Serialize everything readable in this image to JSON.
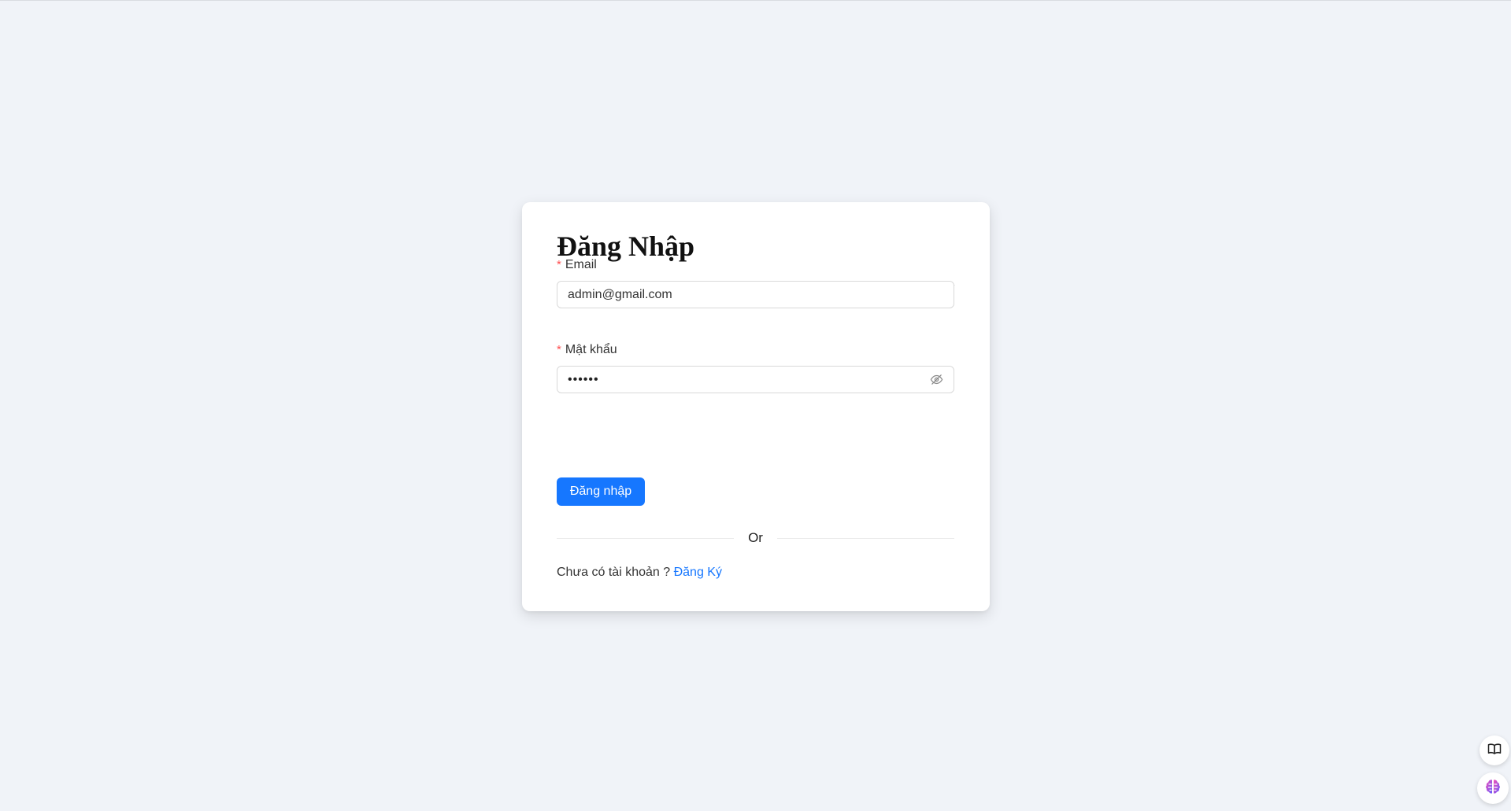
{
  "page": {
    "title": "Đăng Nhập"
  },
  "form": {
    "email": {
      "label": "Email",
      "required_mark": "*",
      "value": "admin@gmail.com"
    },
    "password": {
      "label": "Mật khẩu",
      "required_mark": "*",
      "masked_value": "••••••"
    },
    "submit_label": "Đăng nhập",
    "divider_text": "Or",
    "signup_prompt": "Chưa có tài khoản ?",
    "signup_link": "Đăng Ký"
  },
  "floating": {
    "book_icon": "book-icon",
    "brain_icon": "brain-icon"
  },
  "colors": {
    "primary": "#1677ff",
    "required": "#ff4d4f",
    "background": "#f0f3f8"
  }
}
